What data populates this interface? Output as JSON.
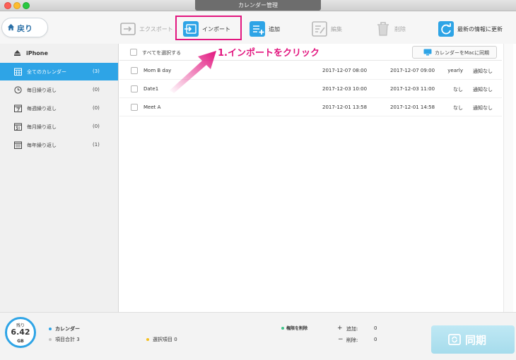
{
  "window": {
    "title": "カレンダー管理"
  },
  "toolbar": {
    "back_label": "戻り",
    "export_label": "エクスポート",
    "import_label": "インポート",
    "add_label": "追加",
    "edit_label": "編集",
    "delete_label": "削除",
    "refresh_label": "最新の情報に更新"
  },
  "sidebar": {
    "device": "iPhone",
    "items": [
      {
        "label": "全てのカレンダー",
        "count": "(3)",
        "icon": "calendar-grid-icon"
      },
      {
        "label": "毎日繰り返し",
        "count": "(0)",
        "icon": "clock-repeat-icon"
      },
      {
        "label": "毎週繰り返し",
        "count": "(0)",
        "icon": "calendar-7-icon"
      },
      {
        "label": "毎月繰り返し",
        "count": "(0)",
        "icon": "calendar-31-icon"
      },
      {
        "label": "毎年繰り返し",
        "count": "(1)",
        "icon": "calendar-365-icon"
      }
    ]
  },
  "list": {
    "select_all": "すべてを選択する",
    "sync_mac": "カレンダーをMacに同期",
    "rows": [
      {
        "name": "Mom  B day",
        "start": "2017-12-07 08:00",
        "end": "2017-12-07 09:00",
        "repeat": "yearly",
        "alert": "通知なし"
      },
      {
        "name": "Date1",
        "start": "2017-12-03 10:00",
        "end": "2017-12-03 11:00",
        "repeat": "なし",
        "alert": "通知なし"
      },
      {
        "name": "Meet A",
        "start": "2017-12-01 13:58",
        "end": "2017-12-01 14:58",
        "repeat": "なし",
        "alert": "通知なし"
      }
    ]
  },
  "annotation": {
    "text": "1.インポートをクリック",
    "color": "#e2167f"
  },
  "footer": {
    "storage_prefix": "残り",
    "storage_value": "6.42",
    "storage_unit": "GB",
    "legend_calendar": "カレンダー",
    "total_items": "項目合計 3",
    "selected_items": "選択項目 0",
    "remove_permission": "権限を削除",
    "add_label": "追加:",
    "add_count": "0",
    "delete_label": "削除:",
    "delete_count": "0",
    "sync_label": "同期"
  },
  "colors": {
    "accent": "#2ea4e6",
    "highlight": "#e2167f",
    "selected_row": "#2ea4e6"
  }
}
